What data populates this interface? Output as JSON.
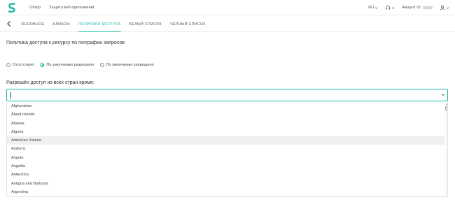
{
  "topnav": {
    "overview": "Обзор",
    "waf": "Защита веб-приложений"
  },
  "topright": {
    "lang": "RU",
    "account_label": "Аккаунт ID:"
  },
  "tabs": [
    {
      "label": "ОСНОВНОЕ"
    },
    {
      "label": "АЛИАСЫ"
    },
    {
      "label": "ПОЛИТИКИ ДОСТУПА"
    },
    {
      "label": "БЕЛЫЙ СПИСОК"
    },
    {
      "label": "ЧЁРНЫЙ СПИСОК"
    }
  ],
  "active_tab_index": 2,
  "policy": {
    "title": "Политика доступа к ресурсу по географии запросов",
    "options": [
      {
        "label": "Отсутствует",
        "selected": false
      },
      {
        "label": "По умолчанию разрешено",
        "selected": true
      },
      {
        "label": "По умолчанию запрещено",
        "selected": false
      }
    ]
  },
  "allow": {
    "label": "Разрешён доступ из всех стран кроме:",
    "value": ""
  },
  "countries": [
    "Afghanistan",
    "Åland Islands",
    "Albania",
    "Algeria",
    "American Samoa",
    "Andorra",
    "Angola",
    "Anguilla",
    "Antarctica",
    "Antigua and Barbuda",
    "Argentina"
  ],
  "hovered_country_index": 4,
  "colors": {
    "accent": "#1ab9a2",
    "hover": "#f0f0f0"
  }
}
